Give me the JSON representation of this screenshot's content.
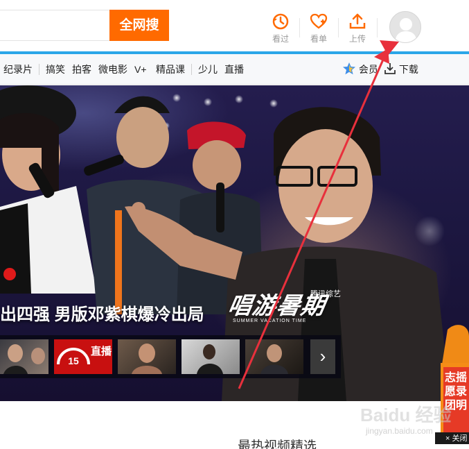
{
  "header": {
    "search_button": "全网搜",
    "icons": [
      {
        "name": "history-icon",
        "label": "看过"
      },
      {
        "name": "watchlist-heart-icon",
        "label": "看单"
      },
      {
        "name": "upload-icon",
        "label": "上传"
      }
    ]
  },
  "nav": {
    "items": [
      "纪录片",
      "搞笑",
      "拍客",
      "微电影",
      "V+",
      "精品课",
      "少儿",
      "直播"
    ],
    "vip_label": "会员",
    "download_label": "下载"
  },
  "banner": {
    "headline": "出四强 男版邓紫棋爆冷出局",
    "show_logo": "唱游暑期",
    "show_sub": "腾讯综艺",
    "show_en": "SUMMER VACATION TIME",
    "thumbs": [
      {
        "name": "thumb-1"
      },
      {
        "name": "thumb-live",
        "number": "15",
        "text": "直播"
      },
      {
        "name": "thumb-3"
      },
      {
        "name": "thumb-4"
      },
      {
        "name": "thumb-5"
      }
    ],
    "next_glyph": "›"
  },
  "promo": {
    "text": "志摇愿录团明"
  },
  "section": {
    "title": "最热视频精选"
  },
  "watermark": {
    "brand": "Baidu 经验",
    "url": "jingyan.baidu.com"
  },
  "close": {
    "label": "× 关闭"
  },
  "colors": {
    "accent_orange": "#ff6a00",
    "accent_blue": "#2aa6e8",
    "arrow_red": "#e8303c"
  }
}
